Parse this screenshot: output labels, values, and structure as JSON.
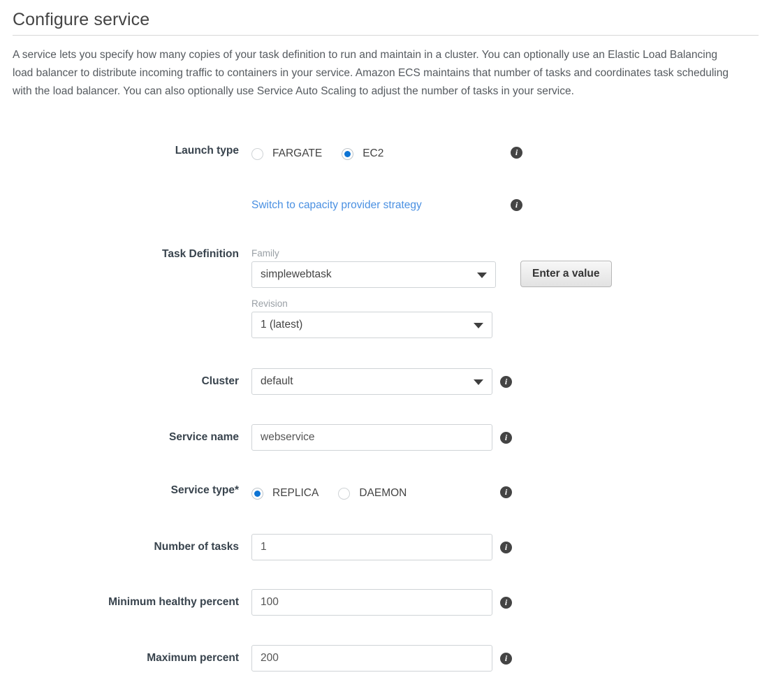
{
  "header": {
    "title": "Configure service",
    "description": "A service lets you specify how many copies of your task definition to run and maintain in a cluster. You can optionally use an Elastic Load Balancing load balancer to distribute incoming traffic to containers in your service. Amazon ECS maintains that number of tasks and coordinates task scheduling with the load balancer. You can also optionally use Service Auto Scaling to adjust the number of tasks in your service."
  },
  "icons": {
    "info": "i",
    "info_name": "info-icon",
    "caret": "caret-down-icon"
  },
  "form": {
    "launch_type": {
      "label": "Launch type",
      "options": [
        {
          "value": "FARGATE",
          "label": "FARGATE",
          "selected": false
        },
        {
          "value": "EC2",
          "label": "EC2",
          "selected": true
        }
      ]
    },
    "capacity_provider_link": {
      "label": "Switch to capacity provider strategy"
    },
    "task_definition": {
      "label": "Task Definition",
      "family": {
        "sub_label": "Family",
        "value": "simplewebtask"
      },
      "revision": {
        "sub_label": "Revision",
        "value": "1 (latest)"
      },
      "enter_value_button": "Enter a value"
    },
    "cluster": {
      "label": "Cluster",
      "value": "default"
    },
    "service_name": {
      "label": "Service name",
      "value": "webservice",
      "placeholder": ""
    },
    "service_type": {
      "label": "Service type*",
      "options": [
        {
          "value": "REPLICA",
          "label": "REPLICA",
          "selected": true
        },
        {
          "value": "DAEMON",
          "label": "DAEMON",
          "selected": false
        }
      ]
    },
    "number_of_tasks": {
      "label": "Number of tasks",
      "value": "1"
    },
    "minimum_healthy_percent": {
      "label": "Minimum healthy percent",
      "value": "100"
    },
    "maximum_percent": {
      "label": "Maximum percent",
      "value": "200"
    }
  },
  "colors": {
    "accent_blue": "#0d74d4",
    "link_blue": "#4a90e2",
    "label_text": "#38434d",
    "body_text": "#555a5f",
    "border": "#cfd3d6"
  }
}
